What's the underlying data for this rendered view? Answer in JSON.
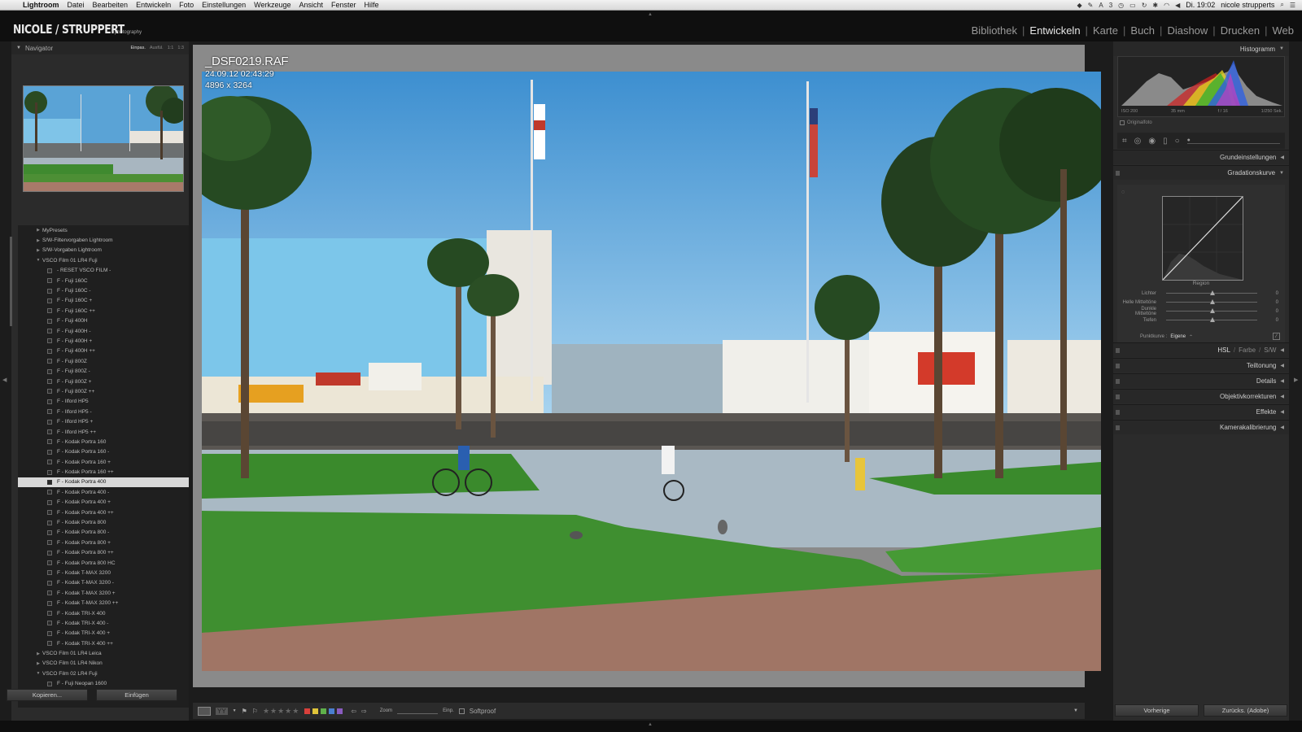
{
  "menubar": {
    "app": "Lightroom",
    "items": [
      "Datei",
      "Bearbeiten",
      "Entwickeln",
      "Foto",
      "Einstellungen",
      "Werkzeuge",
      "Ansicht",
      "Fenster",
      "Hilfe"
    ],
    "status_icons": [
      "dropbox-icon",
      "pen-icon",
      "adobe-icon",
      "time-machine-icon",
      "display-icon",
      "sync-icon",
      "bluetooth-icon",
      "wifi-icon",
      "volume-icon"
    ],
    "badge": "3",
    "clock": "Di. 19:02",
    "user": "nicole strupperts"
  },
  "identity": {
    "logo": "NICOLE / STRUPPERT",
    "logo_sub": "photography"
  },
  "modules": [
    {
      "label": "Bibliothek",
      "active": false
    },
    {
      "label": "Entwickeln",
      "active": true
    },
    {
      "label": "Karte",
      "active": false
    },
    {
      "label": "Buch",
      "active": false
    },
    {
      "label": "Diashow",
      "active": false
    },
    {
      "label": "Drucken",
      "active": false
    },
    {
      "label": "Web",
      "active": false
    }
  ],
  "navigator": {
    "title": "Navigator",
    "options": [
      "Einpas.",
      "Ausfül.",
      "1:1",
      "1:3"
    ]
  },
  "presets": [
    {
      "label": "MyPresets",
      "level": 0,
      "expanded": false
    },
    {
      "label": "S/W-Filtervorgaben Lightroom",
      "level": 0,
      "expanded": false
    },
    {
      "label": "S/W-Vorgaben Lightroom",
      "level": 0,
      "expanded": false
    },
    {
      "label": "VSCO Film 01 LR4 Fuji",
      "level": 0,
      "expanded": true
    },
    {
      "label": "- RESET VSCO FILM -",
      "level": 1
    },
    {
      "label": "F - Fuji 160C",
      "level": 1
    },
    {
      "label": "F - Fuji 160C -",
      "level": 1
    },
    {
      "label": "F - Fuji 160C +",
      "level": 1
    },
    {
      "label": "F - Fuji 160C ++",
      "level": 1
    },
    {
      "label": "F - Fuji 400H",
      "level": 1
    },
    {
      "label": "F - Fuji 400H -",
      "level": 1
    },
    {
      "label": "F - Fuji 400H +",
      "level": 1
    },
    {
      "label": "F - Fuji 400H ++",
      "level": 1
    },
    {
      "label": "F - Fuji 800Z",
      "level": 1
    },
    {
      "label": "F - Fuji 800Z -",
      "level": 1
    },
    {
      "label": "F - Fuji 800Z +",
      "level": 1
    },
    {
      "label": "F - Fuji 800Z ++",
      "level": 1
    },
    {
      "label": "F - Ilford HP5",
      "level": 1
    },
    {
      "label": "F - Ilford HP5 -",
      "level": 1
    },
    {
      "label": "F - Ilford HP5 +",
      "level": 1
    },
    {
      "label": "F - Ilford HP5 ++",
      "level": 1
    },
    {
      "label": "F - Kodak Portra 160",
      "level": 1
    },
    {
      "label": "F - Kodak Portra 160 -",
      "level": 1
    },
    {
      "label": "F - Kodak Portra 160 +",
      "level": 1
    },
    {
      "label": "F - Kodak Portra 160 ++",
      "level": 1
    },
    {
      "label": "F - Kodak Portra 400",
      "level": 1,
      "selected": true
    },
    {
      "label": "F - Kodak Portra 400 -",
      "level": 1
    },
    {
      "label": "F - Kodak Portra 400 +",
      "level": 1
    },
    {
      "label": "F - Kodak Portra 400 ++",
      "level": 1
    },
    {
      "label": "F - Kodak Portra 800",
      "level": 1
    },
    {
      "label": "F - Kodak Portra 800 -",
      "level": 1
    },
    {
      "label": "F - Kodak Portra 800 +",
      "level": 1
    },
    {
      "label": "F - Kodak Portra 800 ++",
      "level": 1
    },
    {
      "label": "F - Kodak Portra 800 HC",
      "level": 1
    },
    {
      "label": "F - Kodak T-MAX 3200",
      "level": 1
    },
    {
      "label": "F - Kodak T-MAX 3200 -",
      "level": 1
    },
    {
      "label": "F - Kodak T-MAX 3200 +",
      "level": 1
    },
    {
      "label": "F - Kodak T-MAX 3200 ++",
      "level": 1
    },
    {
      "label": "F - Kodak TRI-X 400",
      "level": 1
    },
    {
      "label": "F - Kodak TRI-X 400 -",
      "level": 1
    },
    {
      "label": "F - Kodak TRI-X 400 +",
      "level": 1
    },
    {
      "label": "F - Kodak TRI-X 400 ++",
      "level": 1
    },
    {
      "label": "VSCO Film 01 LR4 Leica",
      "level": 0,
      "expanded": false
    },
    {
      "label": "VSCO Film 01 LR4 Nikon",
      "level": 0,
      "expanded": false
    },
    {
      "label": "VSCO Film 02 LR4 Fuji",
      "level": 0,
      "expanded": true
    },
    {
      "label": "F - Fuji Neopan 1600",
      "level": 1
    }
  ],
  "left_footer": {
    "copy": "Kopieren...",
    "paste": "Einfügen"
  },
  "photo_info": {
    "filename": "_DSF0219.RAF",
    "datetime": "24.09.12 02:43:29",
    "dimensions": "4896 x 3264"
  },
  "toolbar": {
    "zoom_label": "Zoom",
    "fit_label": "Einp.",
    "softproof": "Softproof",
    "label_colors": [
      "#d9403b",
      "#e0c43a",
      "#5fb04a",
      "#4a7fd0",
      "#8a5cc0"
    ]
  },
  "right_panel": {
    "histogram_title": "Histogramm",
    "histo_meta": {
      "iso": "ISO 200",
      "focal": "35 mm",
      "aperture": "f / 16",
      "shutter": "1/250 Sek."
    },
    "original_photo": "Originalfoto",
    "sections_top": [
      "Grundeinstellungen",
      "Gradationskurve"
    ],
    "region_label": "Region",
    "region_sliders": [
      {
        "label": "Lichter",
        "value": "0"
      },
      {
        "label": "Helle Mitteltöne",
        "value": "0"
      },
      {
        "label": "Dunkle Mitteltöne",
        "value": "0"
      },
      {
        "label": "Tiefen",
        "value": "0"
      }
    ],
    "point_curve_label": "Punktkurve :",
    "point_curve_value": "Eigene",
    "hsl_tabs": [
      "HSL",
      "Farbe",
      "S/W"
    ],
    "sections_bottom": [
      "Teiltonung",
      "Details",
      "Objektivkorrekturen",
      "Effekte",
      "Kamerakalibrierung"
    ]
  },
  "right_footer": {
    "previous": "Vorherige",
    "reset": "Zurücks. (Adobe)"
  }
}
